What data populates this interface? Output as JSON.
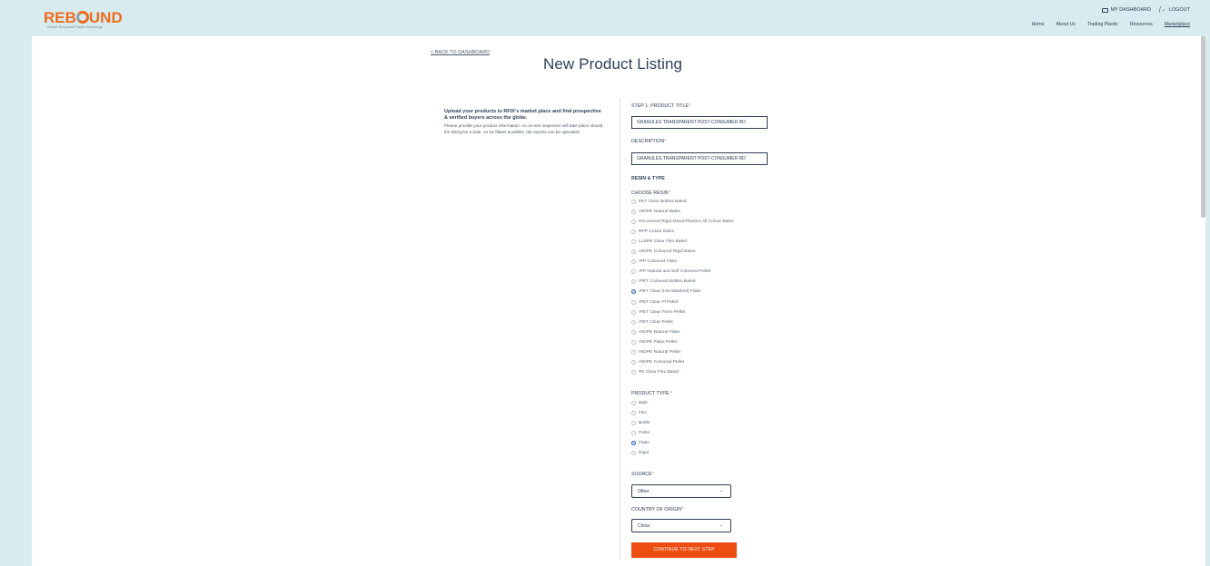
{
  "header": {
    "logo_text_a": "REB",
    "logo_text_b": "UND",
    "tagline": "Global Recycled Plastic Exchange",
    "my_dashboard": "MY DASHBOARD",
    "logout": "LOGOUT",
    "nav": [
      "Home",
      "About Us",
      "Trading Plastic",
      "Resources",
      "Marketplace"
    ]
  },
  "back_link": "< BACK TO DASHBOARD",
  "page_title": "New Product Listing",
  "intro": {
    "heading": "Upload your products to RFIX's market place and find prospective & verified buyers across the globe.",
    "body": "Please provide your product information. An on-site inspection will take place should the listing be a bale. As for flakes & pellets, lab reports can be uploaded."
  },
  "form": {
    "step1_label": "STEP 1: PRODUCT TITLE",
    "title_value": "GRANULES TRANSPARENT POST-CONSUMER RD",
    "description_label": "DESCRIPTION",
    "description_value": "GRANULES TRANSPARENT POST-CONSUMER RD",
    "resin_type_label": "RESIN & TYPE",
    "choose_resin_label": "CHOOSE RESIN",
    "resins": [
      "PET Clear Bottles Baled",
      "rHDPE Natural Bales",
      "Recovered Rigid Mixed Plastics All Colour Bales",
      "RPP Colour Bales",
      "LLDPE Clear Film Baled",
      "rHDPE Coloured Rigid Bales",
      "rPP Coloured Flake",
      "rPP Natural and Self Coloured Pellet",
      "rPET Coloured Bottles Baled",
      "rPET Clear (Hot Washed) Flake",
      "rPET Clear Pl Pellet",
      "rPET Clear Fines Pellet",
      "rPET Clear Pellet",
      "rHDPE Natural Flake",
      "rHDPE Flake Pellet",
      "rHDPE Natural Pellet",
      "rHDPE Coloured Pellet",
      "PE Clear Film Baled"
    ],
    "selected_resin": "rPET Clear (Hot Washed) Flake",
    "product_type_label": "PRODUCT TYPE:",
    "product_types": [
      "Bale",
      "Film",
      "Bottle",
      "Pellet",
      "Flake",
      "Rigid"
    ],
    "selected_product_type": "Flake",
    "source_label": "SOURCE",
    "source_value": "Other",
    "country_label": "COUNTRY OF ORIGIN",
    "country_value": "China",
    "continue_button": "CONTINUE TO NEXT STEP",
    "required_mark": "*"
  },
  "colors": {
    "accent": "#ee4d12",
    "header_bg": "#d8ebee",
    "text": "#2e4057",
    "radio_selected": "#2b5fb7"
  }
}
